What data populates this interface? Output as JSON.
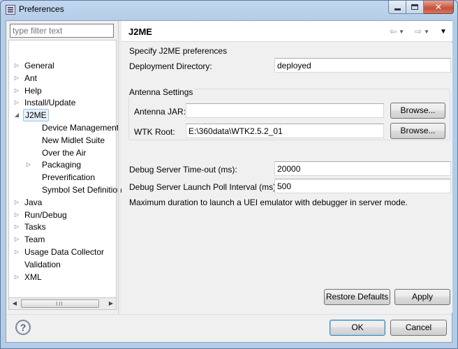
{
  "window": {
    "title": "Preferences",
    "close_glyph": "✕"
  },
  "filter": {
    "placeholder": "type filter text"
  },
  "tree": {
    "items": [
      {
        "label": "General",
        "expandable": true
      },
      {
        "label": "Ant",
        "expandable": true
      },
      {
        "label": "Help",
        "expandable": true
      },
      {
        "label": "Install/Update",
        "expandable": true
      },
      {
        "label": "J2ME",
        "expanded": true,
        "selected": true
      },
      {
        "label": "Device Management"
      },
      {
        "label": "New Midlet Suite"
      },
      {
        "label": "Over the Air"
      },
      {
        "label": "Packaging",
        "expandable": true
      },
      {
        "label": "Preverification"
      },
      {
        "label": "Symbol Set Definition"
      },
      {
        "label": "Java",
        "expandable": true
      },
      {
        "label": "Run/Debug",
        "expandable": true
      },
      {
        "label": "Tasks",
        "expandable": true
      },
      {
        "label": "Team",
        "expandable": true
      },
      {
        "label": "Usage Data Collector",
        "expandable": true
      },
      {
        "label": "Validation"
      },
      {
        "label": "XML",
        "expandable": true
      }
    ]
  },
  "page": {
    "title": "J2ME",
    "description": "Specify J2ME preferences",
    "deployment_dir_label": "Deployment Directory:",
    "deployment_dir_value": "deployed",
    "antenna_group": "Antenna Settings",
    "antenna_jar_label": "Antenna JAR:",
    "antenna_jar_value": "",
    "wtk_root_label": "WTK Root:",
    "wtk_root_value": "E:\\360data\\WTK2.5.2_01",
    "browse_label": "Browse...",
    "debug_timeout_label": "Debug Server Time-out (ms):",
    "debug_timeout_value": "20000",
    "poll_interval_label": "Debug Server Launch Poll Interval (ms)",
    "poll_interval_value": "500",
    "poll_note": "Maximum duration to launch a UEI emulator with debugger in server mode.",
    "restore_defaults": "Restore Defaults",
    "apply": "Apply"
  },
  "footer": {
    "ok": "OK",
    "cancel": "Cancel",
    "help": "?"
  },
  "icons": {
    "back": "⇦",
    "forward": "⇨",
    "dropdown": "▼",
    "menu": "▼",
    "expand": "▷",
    "expanded": "◢",
    "scroll_left": "◀",
    "scroll_right": "▶"
  }
}
